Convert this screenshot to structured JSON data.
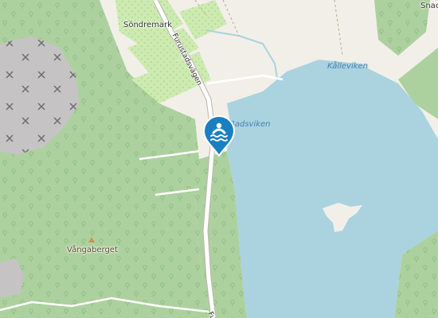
{
  "map": {
    "labels": {
      "place_sondremark": "Söndremark",
      "place_snack": "Snack",
      "road_furustadsvagen_top": "Furustadsvägen",
      "road_furustadsvagen_bottom": "Fu",
      "water_kalleviken": "Kålleviken",
      "water_badsviken": "Badsviken",
      "peak_vangaberget": "Vångaberget"
    },
    "marker": {
      "icon": "swimming-icon",
      "color": "#1a7fc1"
    },
    "colors": {
      "land": "#f2efe9",
      "forest": "#add19e",
      "meadow": "#cdebb0",
      "water": "#aad3df",
      "quarry": "#c5c3c3",
      "road": "#ffffff",
      "road_casing": "#b9b4ac"
    }
  }
}
